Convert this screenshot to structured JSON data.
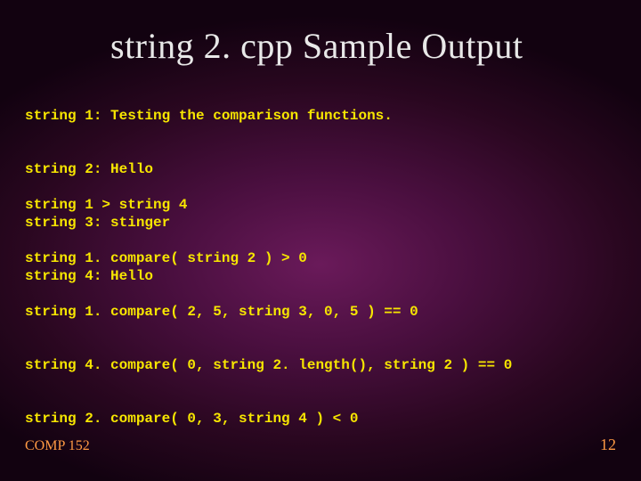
{
  "title": "string 2. cpp Sample Output",
  "block1": {
    "lines": [
      "string 1: Testing the comparison functions.",
      "string 2: Hello",
      "string 3: stinger",
      "string 4: Hello"
    ]
  },
  "block2": {
    "lines": [
      "string 1 > string 4",
      "string 1. compare( string 2 ) > 0",
      "string 1. compare( 2, 5, string 3, 0, 5 ) == 0",
      "string 4. compare( 0, string 2. length(), string 2 ) == 0",
      "string 2. compare( 0, 3, string 4 ) < 0"
    ]
  },
  "footer": {
    "left": "COMP 152",
    "right": "12"
  }
}
